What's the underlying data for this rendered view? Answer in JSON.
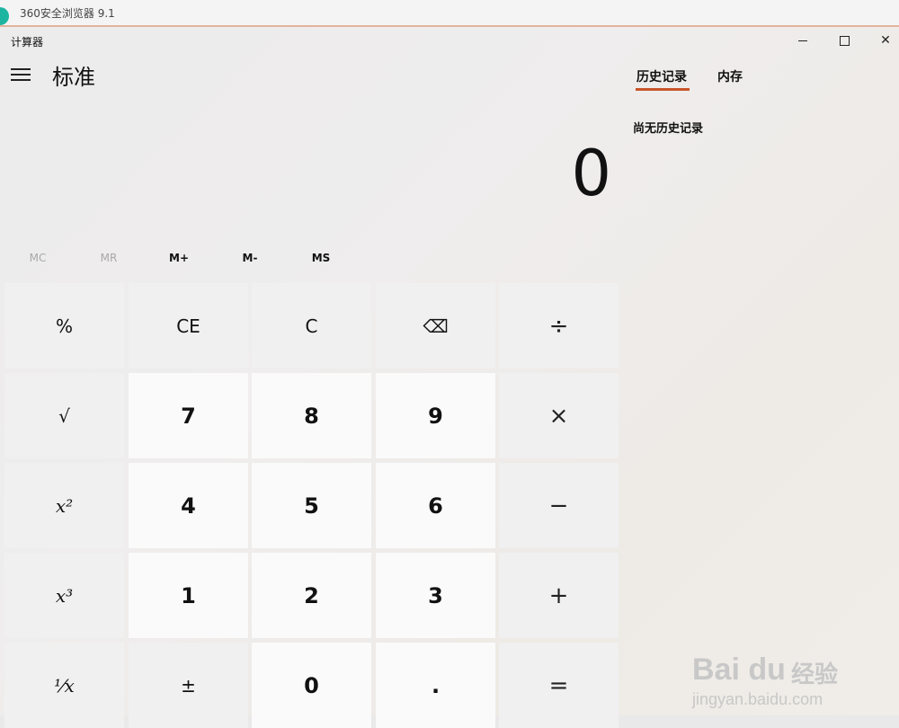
{
  "browser": {
    "title": "360安全浏览器 9.1"
  },
  "app": {
    "title": "计算器",
    "mode": "标准"
  },
  "window": {
    "minimize": "",
    "maximize": "",
    "close": "✕"
  },
  "tabs": [
    {
      "label": "历史记录",
      "active": true
    },
    {
      "label": "内存",
      "active": false
    }
  ],
  "history": {
    "empty_text": "尚无历史记录"
  },
  "display": {
    "value": "0"
  },
  "memory_buttons": [
    {
      "label": "MC",
      "enabled": false
    },
    {
      "label": "MR",
      "enabled": false
    },
    {
      "label": "M+",
      "enabled": true
    },
    {
      "label": "M-",
      "enabled": true
    },
    {
      "label": "MS",
      "enabled": true
    }
  ],
  "keys": {
    "row1": [
      "%",
      "CE",
      "C",
      "⌫",
      "÷"
    ],
    "row2": [
      "√",
      "7",
      "8",
      "9",
      "×"
    ],
    "row3": [
      "x²",
      "4",
      "5",
      "6",
      "−"
    ],
    "row4": [
      "x³",
      "1",
      "2",
      "3",
      "+"
    ],
    "row5": [
      "¹⁄x",
      "±",
      "0",
      ".",
      "="
    ]
  },
  "watermark": {
    "brand": "Bai du",
    "cn": "经验",
    "url": "jingyan.baidu.com"
  },
  "colors": {
    "accent": "#c8562a",
    "browser_logo": "#1db5a0"
  }
}
